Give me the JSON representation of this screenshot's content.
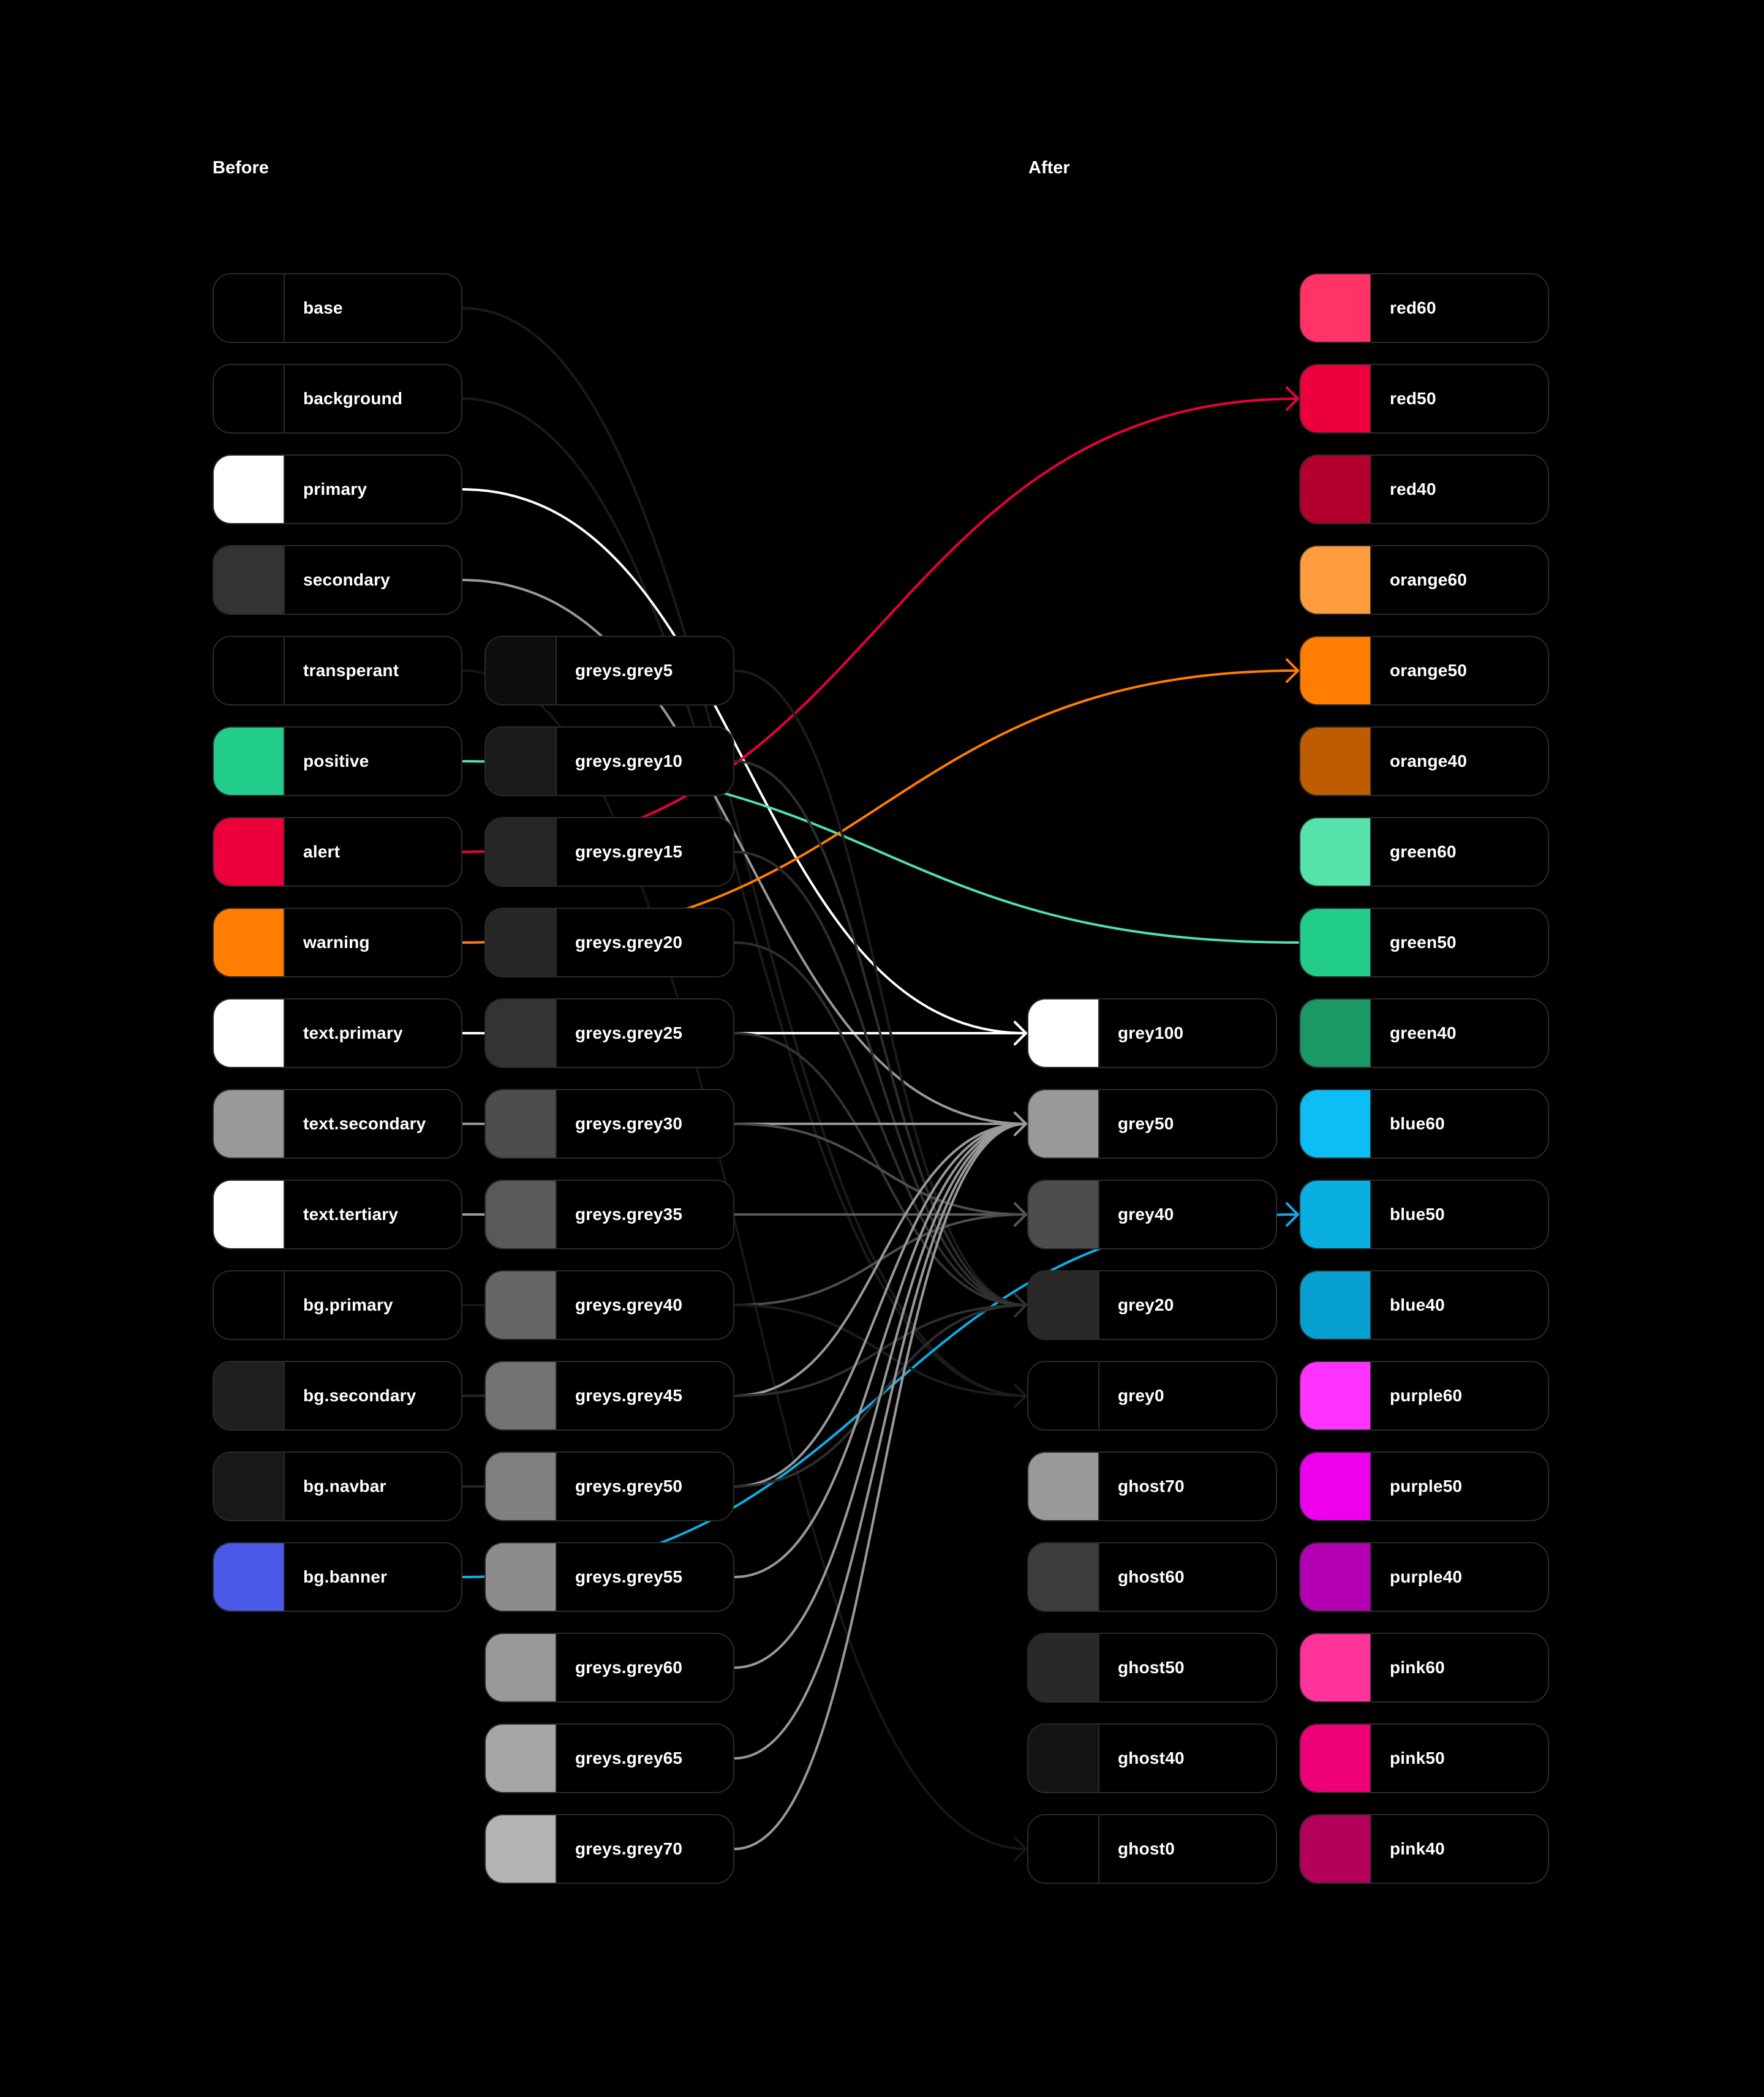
{
  "labels": {
    "before": "Before",
    "after": "After"
  },
  "before": [
    {
      "name": "base",
      "color": "#000000"
    },
    {
      "name": "background",
      "color": "#000000"
    },
    {
      "name": "primary",
      "color": "#ffffff"
    },
    {
      "name": "secondary",
      "color": "#333333"
    },
    {
      "name": "transperant",
      "color": "#000000"
    },
    {
      "name": "positive",
      "color": "#22cc8a"
    },
    {
      "name": "alert",
      "color": "#ec003b"
    },
    {
      "name": "warning",
      "color": "#ff7d00"
    },
    {
      "name": "text.primary",
      "color": "#ffffff"
    },
    {
      "name": "text.secondary",
      "color": "#999999"
    },
    {
      "name": "text.tertiary",
      "color": "#ffffff"
    },
    {
      "name": "bg.primary",
      "color": "#000000"
    },
    {
      "name": "bg.secondary",
      "color": "#1f1f1f"
    },
    {
      "name": "bg.navbar",
      "color": "#181818"
    },
    {
      "name": "bg.banner",
      "color": "#4a5ae6"
    }
  ],
  "greys": [
    {
      "name": "greys.grey5",
      "color": "#0d0d0d"
    },
    {
      "name": "greys.grey10",
      "color": "#1a1a1a"
    },
    {
      "name": "greys.grey15",
      "color": "#262626"
    },
    {
      "name": "greys.grey20",
      "color": "#262626"
    },
    {
      "name": "greys.grey25",
      "color": "#333333"
    },
    {
      "name": "greys.grey30",
      "color": "#4d4d4d"
    },
    {
      "name": "greys.grey35",
      "color": "#595959"
    },
    {
      "name": "greys.grey40",
      "color": "#666666"
    },
    {
      "name": "greys.grey45",
      "color": "#737373"
    },
    {
      "name": "greys.grey50",
      "color": "#808080"
    },
    {
      "name": "greys.grey55",
      "color": "#8c8c8c"
    },
    {
      "name": "greys.grey60",
      "color": "#999999"
    },
    {
      "name": "greys.grey65",
      "color": "#a6a6a6"
    },
    {
      "name": "greys.grey70",
      "color": "#b3b3b3"
    }
  ],
  "after_greys": [
    {
      "name": "grey100",
      "color": "#ffffff"
    },
    {
      "name": "grey50",
      "color": "#999999"
    },
    {
      "name": "grey40",
      "color": "#4d4d4d"
    },
    {
      "name": "grey20",
      "color": "#292929"
    },
    {
      "name": "grey0",
      "color": "#000000"
    },
    {
      "name": "ghost70",
      "color": "#999999"
    },
    {
      "name": "ghost60",
      "color": "#3d3d3d"
    },
    {
      "name": "ghost50",
      "color": "#292929"
    },
    {
      "name": "ghost40",
      "color": "#141414"
    },
    {
      "name": "ghost0",
      "color": "#000000"
    }
  ],
  "after_colors": [
    {
      "name": "red60",
      "color": "#ff3366"
    },
    {
      "name": "red50",
      "color": "#ec003b"
    },
    {
      "name": "red40",
      "color": "#b3002d"
    },
    {
      "name": "orange60",
      "color": "#ff9c40"
    },
    {
      "name": "orange50",
      "color": "#ff7d00"
    },
    {
      "name": "orange40",
      "color": "#bd5c00"
    },
    {
      "name": "green60",
      "color": "#55e3ab"
    },
    {
      "name": "green50",
      "color": "#22cc8a"
    },
    {
      "name": "green40",
      "color": "#1a9966"
    },
    {
      "name": "blue60",
      "color": "#0dbdf5"
    },
    {
      "name": "blue50",
      "color": "#08afe0"
    },
    {
      "name": "blue40",
      "color": "#08a0d0"
    },
    {
      "name": "purple60",
      "color": "#ff33ff"
    },
    {
      "name": "purple50",
      "color": "#ee00ee"
    },
    {
      "name": "purple40",
      "color": "#b300b3"
    },
    {
      "name": "pink60",
      "color": "#ff3399"
    },
    {
      "name": "pink50",
      "color": "#ee0077"
    },
    {
      "name": "pink40",
      "color": "#b3005a"
    }
  ],
  "links": [
    {
      "from": "before:base",
      "to": "after_greys:grey0",
      "color": "#1a1a1a",
      "arrow": true
    },
    {
      "from": "before:background",
      "to": "after_greys:grey0",
      "color": "#1a1a1a",
      "arrow": false
    },
    {
      "from": "before:primary",
      "to": "after_greys:grey100",
      "color": "#ffffff",
      "arrow": true
    },
    {
      "from": "before:secondary",
      "to": "after_greys:grey50",
      "color": "#999999",
      "arrow": true
    },
    {
      "from": "before:transperant",
      "to": "after_greys:ghost0",
      "color": "#161616",
      "arrow": true
    },
    {
      "from": "before:positive",
      "to": "after_colors:green50",
      "color": "#4fe0b0",
      "arrow": false
    },
    {
      "from": "before:alert",
      "to": "after_colors:red50",
      "color": "#ec003b",
      "arrow": true
    },
    {
      "from": "before:warning",
      "to": "after_colors:orange50",
      "color": "#ff7d00",
      "arrow": true
    },
    {
      "from": "before:text.primary",
      "to": "after_greys:grey100",
      "color": "#ffffff",
      "arrow": true
    },
    {
      "from": "before:text.secondary",
      "to": "greys:greys.grey30",
      "color": "#999999",
      "arrow": false
    },
    {
      "from": "before:text.tertiary",
      "to": "greys:greys.grey35",
      "color": "#999999",
      "arrow": false
    },
    {
      "from": "before:bg.primary",
      "to": "greys:greys.grey40",
      "color": "#161616",
      "arrow": false
    },
    {
      "from": "before:bg.secondary",
      "to": "greys:greys.grey45",
      "color": "#262626",
      "arrow": false
    },
    {
      "from": "before:bg.navbar",
      "to": "greys:greys.grey50",
      "color": "#262626",
      "arrow": false
    },
    {
      "from": "before:bg.banner",
      "to": "after_colors:blue50",
      "color": "#0dafe6",
      "arrow": true
    },
    {
      "from": "greys:greys.grey5",
      "to": "after_greys:grey20",
      "color": "#1c1c1c",
      "arrow": false
    },
    {
      "from": "greys:greys.grey10",
      "to": "after_greys:grey20",
      "color": "#2e2e2e",
      "arrow": false
    },
    {
      "from": "greys:greys.grey15",
      "to": "after_greys:grey20",
      "color": "#2e2e2e",
      "arrow": false
    },
    {
      "from": "greys:greys.grey20",
      "to": "after_greys:grey20",
      "color": "#2e2e2e",
      "arrow": false
    },
    {
      "from": "greys:greys.grey25",
      "to": "after_greys:grey20",
      "color": "#333333",
      "arrow": true
    },
    {
      "from": "greys:greys.grey30",
      "to": "after_greys:grey50",
      "color": "#999999",
      "arrow": true
    },
    {
      "from": "greys:greys.grey30",
      "to": "after_greys:grey40",
      "color": "#4d4d4d",
      "arrow": false
    },
    {
      "from": "greys:greys.grey35",
      "to": "after_greys:grey40",
      "color": "#595959",
      "arrow": true
    },
    {
      "from": "greys:greys.grey40",
      "to": "after_greys:grey40",
      "color": "#4d4d4d",
      "arrow": false
    },
    {
      "from": "greys:greys.grey40",
      "to": "after_greys:grey0",
      "color": "#1c1c1c",
      "arrow": false
    },
    {
      "from": "greys:greys.grey45",
      "to": "after_greys:grey50",
      "color": "#999999",
      "arrow": false
    },
    {
      "from": "greys:greys.grey45",
      "to": "after_greys:grey20",
      "color": "#2e2e2e",
      "arrow": false
    },
    {
      "from": "greys:greys.grey50",
      "to": "after_greys:grey50",
      "color": "#999999",
      "arrow": false
    },
    {
      "from": "greys:greys.grey50",
      "to": "after_greys:grey20",
      "color": "#2e2e2e",
      "arrow": false
    },
    {
      "from": "greys:greys.grey55",
      "to": "after_greys:grey50",
      "color": "#999999",
      "arrow": false
    },
    {
      "from": "greys:greys.grey60",
      "to": "after_greys:grey50",
      "color": "#999999",
      "arrow": false
    },
    {
      "from": "greys:greys.grey65",
      "to": "after_greys:grey50",
      "color": "#999999",
      "arrow": false
    },
    {
      "from": "greys:greys.grey70",
      "to": "after_greys:grey50",
      "color": "#999999",
      "arrow": false
    }
  ]
}
